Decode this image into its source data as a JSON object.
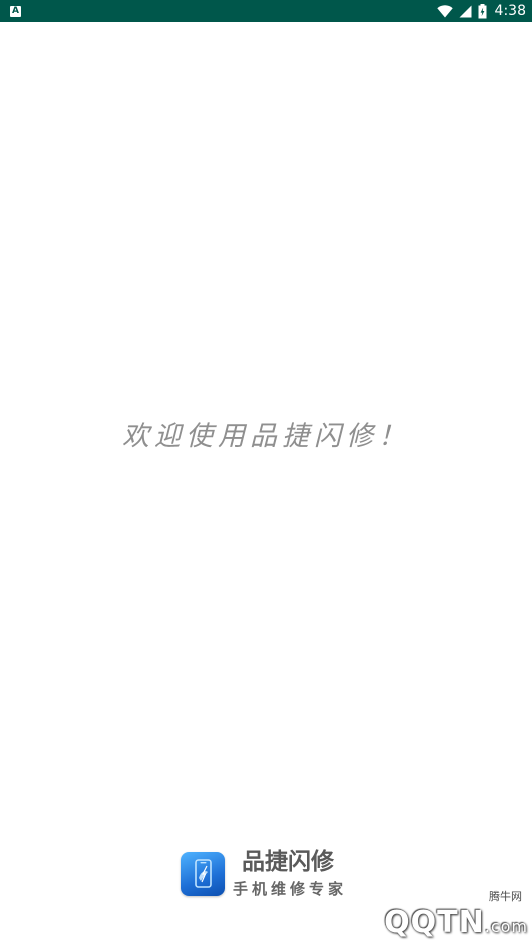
{
  "status_bar": {
    "notification_icon": "A",
    "time": "4:38",
    "icons": [
      "wifi-icon",
      "cell-signal-icon",
      "battery-charging-icon"
    ],
    "background_color": "#00574b"
  },
  "welcome": {
    "text": "欢迎使用品捷闪修！"
  },
  "brand": {
    "app_name": "品捷闪修",
    "slogan": "手机维修专家",
    "logo_icon": "phone-repair-app-icon",
    "logo_color": "#1e6fd6"
  },
  "watermark": {
    "top_text": "腾牛网",
    "main_text": "QQTN",
    "suffix": ".com"
  }
}
